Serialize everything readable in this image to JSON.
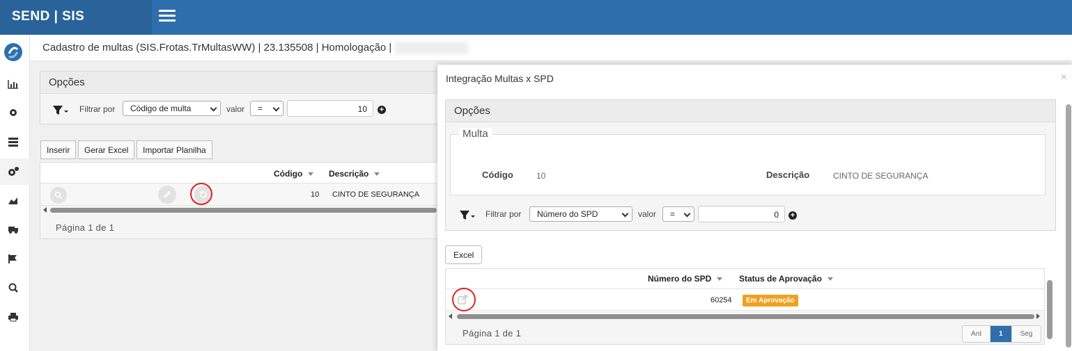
{
  "header": {
    "brand": "SEND | SIS"
  },
  "page": {
    "title": "Cadastro de multas (SIS.Frotas.TrMultasWW) | 23.135508 | Homologação |"
  },
  "main": {
    "options_title": "Opções",
    "filter_label": "Filtrar por",
    "filter_field": "Código de multa",
    "valor_label": "valor",
    "operator": "=",
    "value": "10",
    "buttons": {
      "insert": "Inserir",
      "excel": "Gerar Excel",
      "import": "Importar Planilha"
    },
    "columns": {
      "code": "Código",
      "description": "Descrição"
    },
    "rows": [
      {
        "code": "10",
        "description": "CINTO DE SEGURANÇA"
      }
    ],
    "pagination": "Página 1 de 1"
  },
  "modal": {
    "title": "Integração Multas x SPD",
    "close": "×",
    "options_title": "Opções",
    "legend": "Multa",
    "code_label": "Código",
    "code_value": "10",
    "desc_label": "Descrição",
    "desc_value": "CINTO DE SEGURANÇA",
    "filter_label": "Filtrar por",
    "filter_field": "Número do SPD",
    "valor_label": "valor",
    "operator": "=",
    "value": "0",
    "excel_button": "Excel",
    "columns": {
      "spd": "Número do SPD",
      "status": "Status de Aprovação"
    },
    "rows": [
      {
        "spd": "60254",
        "status": "Em Aprovação"
      }
    ],
    "pagination": "Página 1 de 1",
    "pager": {
      "prev": "Ant",
      "current": "1",
      "next": "Seg"
    }
  },
  "colors": {
    "brand": "#2f6eac",
    "highlight": "#e02020",
    "status_badge": "#f0a020"
  }
}
